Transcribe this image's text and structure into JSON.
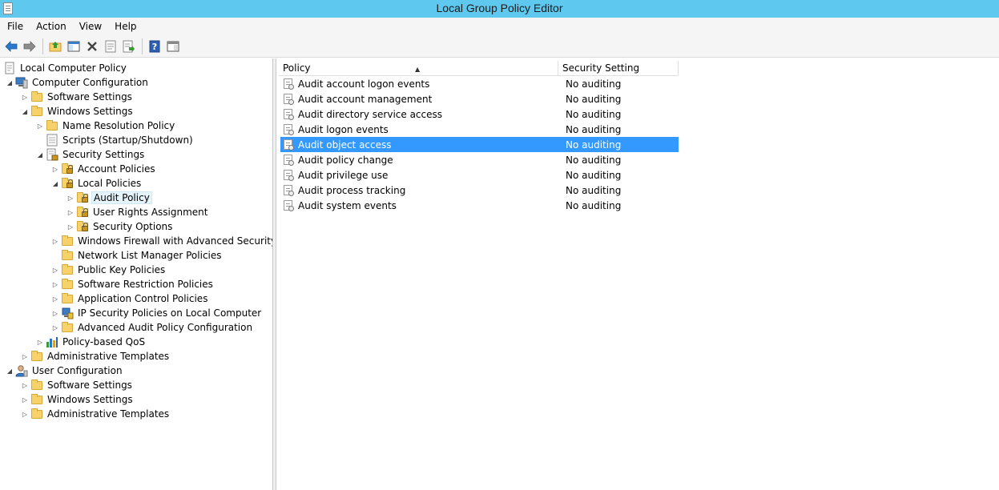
{
  "window": {
    "title": "Local Group Policy Editor"
  },
  "menu": [
    "File",
    "Action",
    "View",
    "Help"
  ],
  "toolbar": {
    "buttons": [
      "back-icon",
      "forward-icon",
      "up-folder-icon",
      "show-hide-tree-icon",
      "delete-icon",
      "properties-icon",
      "export-list-icon",
      "help-icon",
      "show-hide-action-pane-icon"
    ]
  },
  "tree": [
    {
      "label": "Local Computer Policy",
      "expander": "",
      "icon": "policy-doc-icon"
    },
    {
      "label": "Computer Configuration",
      "expander": "◢",
      "icon": "computer-icon"
    },
    {
      "label": "Software Settings",
      "expander": "▷",
      "icon": "folder-icon"
    },
    {
      "label": "Windows Settings",
      "expander": "◢",
      "icon": "folder-icon"
    },
    {
      "label": "Name Resolution Policy",
      "expander": "▷",
      "icon": "folder-icon"
    },
    {
      "label": "Scripts (Startup/Shutdown)",
      "expander": "",
      "icon": "scripts-icon"
    },
    {
      "label": "Security Settings",
      "expander": "◢",
      "icon": "security-settings-icon"
    },
    {
      "label": "Account Policies",
      "expander": "▷",
      "icon": "locked-folder-icon"
    },
    {
      "label": "Local Policies",
      "expander": "◢",
      "icon": "locked-folder-icon"
    },
    {
      "label": "Audit Policy",
      "expander": "▷",
      "icon": "locked-folder-icon"
    },
    {
      "label": "User Rights Assignment",
      "expander": "▷",
      "icon": "locked-folder-icon"
    },
    {
      "label": "Security Options",
      "expander": "▷",
      "icon": "locked-folder-icon"
    },
    {
      "label": "Windows Firewall with Advanced Security",
      "expander": "▷",
      "icon": "folder-icon"
    },
    {
      "label": "Network List Manager Policies",
      "expander": "",
      "icon": "folder-icon"
    },
    {
      "label": "Public Key Policies",
      "expander": "▷",
      "icon": "folder-icon"
    },
    {
      "label": "Software Restriction Policies",
      "expander": "▷",
      "icon": "folder-icon"
    },
    {
      "label": "Application Control Policies",
      "expander": "▷",
      "icon": "folder-icon"
    },
    {
      "label": "IP Security Policies on Local Computer",
      "expander": "▷",
      "icon": "ip-security-icon"
    },
    {
      "label": "Advanced Audit Policy Configuration",
      "expander": "▷",
      "icon": "folder-icon"
    },
    {
      "label": "Policy-based QoS",
      "expander": "▷",
      "icon": "qos-chart-icon"
    },
    {
      "label": "Administrative Templates",
      "expander": "▷",
      "icon": "folder-icon"
    },
    {
      "label": "User Configuration",
      "expander": "◢",
      "icon": "user-icon"
    },
    {
      "label": "Software Settings",
      "expander": "▷",
      "icon": "folder-icon"
    },
    {
      "label": "Windows Settings",
      "expander": "▷",
      "icon": "folder-icon"
    },
    {
      "label": "Administrative Templates",
      "expander": "▷",
      "icon": "folder-icon"
    }
  ],
  "list": {
    "columns": {
      "policy": "Policy",
      "setting": "Security Setting"
    },
    "rows": [
      {
        "policy": "Audit account logon events",
        "setting": "No auditing"
      },
      {
        "policy": "Audit account management",
        "setting": "No auditing"
      },
      {
        "policy": "Audit directory service access",
        "setting": "No auditing"
      },
      {
        "policy": "Audit logon events",
        "setting": "No auditing"
      },
      {
        "policy": "Audit object access",
        "setting": "No auditing"
      },
      {
        "policy": "Audit policy change",
        "setting": "No auditing"
      },
      {
        "policy": "Audit privilege use",
        "setting": "No auditing"
      },
      {
        "policy": "Audit process tracking",
        "setting": "No auditing"
      },
      {
        "policy": "Audit system events",
        "setting": "No auditing"
      }
    ]
  },
  "colors": {
    "titlebar": "#5ec8ef",
    "selection": "#3399ff"
  }
}
